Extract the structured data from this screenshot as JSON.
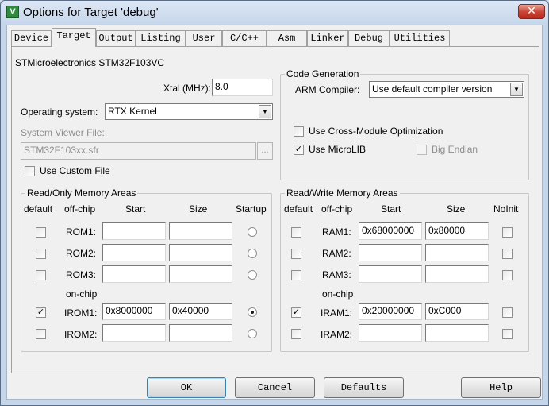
{
  "window": {
    "title": "Options for Target 'debug'",
    "icon_letter": "V",
    "close_glyph": "✕"
  },
  "tabs": [
    {
      "label": "Device",
      "active": false
    },
    {
      "label": "Target",
      "active": true
    },
    {
      "label": "Output",
      "active": false
    },
    {
      "label": "Listing",
      "active": false
    },
    {
      "label": "User",
      "active": false
    },
    {
      "label": "C/C++",
      "active": false
    },
    {
      "label": "Asm",
      "active": false
    },
    {
      "label": "Linker",
      "active": false
    },
    {
      "label": "Debug",
      "active": false
    },
    {
      "label": "Utilities",
      "active": false
    }
  ],
  "device_name": "STMicroelectronics STM32F103VC",
  "xtal": {
    "label": "Xtal (MHz):",
    "value": "8.0"
  },
  "os": {
    "label": "Operating system:",
    "value": "RTX Kernel"
  },
  "svf": {
    "label": "System Viewer File:",
    "value": "STM32F103xx.sfr",
    "browse": "..."
  },
  "use_custom_file": {
    "label": "Use Custom File",
    "checked": false
  },
  "code_gen": {
    "title": "Code Generation",
    "compiler_label": "ARM Compiler:",
    "compiler_value": "Use default compiler version",
    "cross_module": {
      "label": "Use Cross-Module Optimization",
      "checked": false
    },
    "microlib": {
      "label": "Use MicroLIB",
      "checked": true
    },
    "big_endian": {
      "label": "Big Endian",
      "checked": false,
      "enabled": false
    }
  },
  "ro_memory": {
    "title": "Read/Only Memory Areas",
    "headers": {
      "default": "default",
      "offchip": "off-chip",
      "start": "Start",
      "size": "Size",
      "startup": "Startup"
    },
    "onchip_label": "on-chip",
    "rows": [
      {
        "name": "ROM1:",
        "default": false,
        "start": "",
        "size": "",
        "startup": false
      },
      {
        "name": "ROM2:",
        "default": false,
        "start": "",
        "size": "",
        "startup": false
      },
      {
        "name": "ROM3:",
        "default": false,
        "start": "",
        "size": "",
        "startup": false
      },
      {
        "name": "IROM1:",
        "default": true,
        "start": "0x8000000",
        "size": "0x40000",
        "startup": true
      },
      {
        "name": "IROM2:",
        "default": false,
        "start": "",
        "size": "",
        "startup": false
      }
    ]
  },
  "rw_memory": {
    "title": "Read/Write Memory Areas",
    "headers": {
      "default": "default",
      "offchip": "off-chip",
      "start": "Start",
      "size": "Size",
      "noinit": "NoInit"
    },
    "onchip_label": "on-chip",
    "rows": [
      {
        "name": "RAM1:",
        "default": false,
        "start": "0x68000000",
        "size": "0x80000",
        "noinit": false
      },
      {
        "name": "RAM2:",
        "default": false,
        "start": "",
        "size": "",
        "noinit": false
      },
      {
        "name": "RAM3:",
        "default": false,
        "start": "",
        "size": "",
        "noinit": false
      },
      {
        "name": "IRAM1:",
        "default": true,
        "start": "0x20000000",
        "size": "0xC000",
        "noinit": false
      },
      {
        "name": "IRAM2:",
        "default": false,
        "start": "",
        "size": "",
        "noinit": false
      }
    ]
  },
  "buttons": {
    "ok": "OK",
    "cancel": "Cancel",
    "defaults": "Defaults",
    "help": "Help"
  },
  "glyphs": {
    "check": "✓",
    "dropdown": "▼"
  }
}
